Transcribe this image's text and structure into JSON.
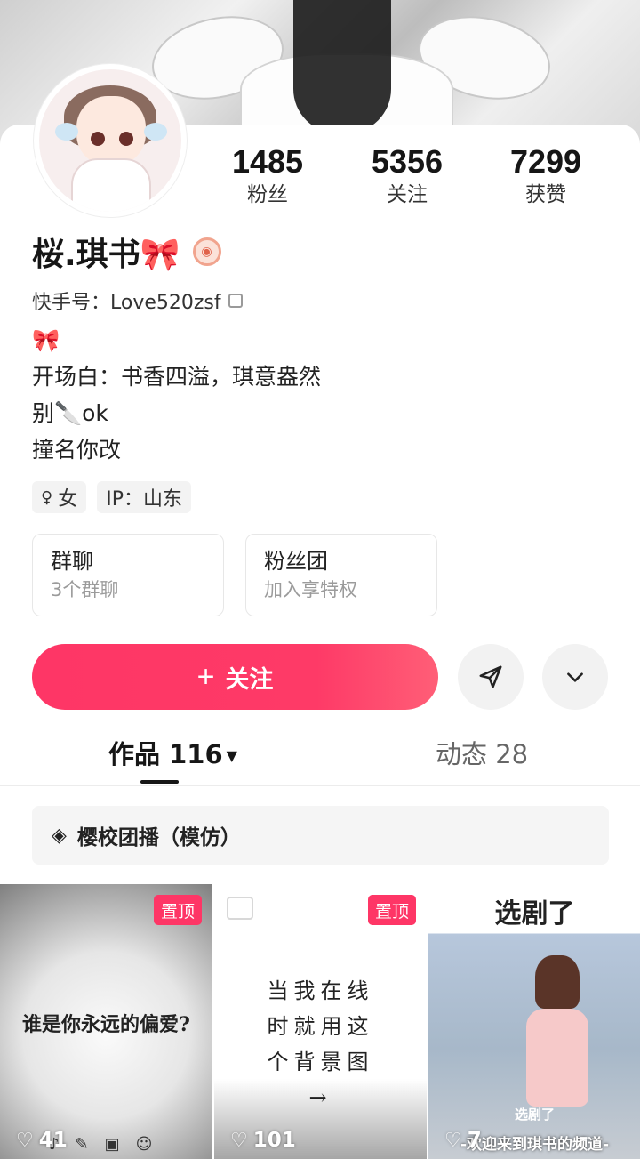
{
  "profile": {
    "name": "桜.琪书🎀",
    "kwai_id": "快手号：Love520zsf",
    "bio_lines": [
      "🎀",
      "开场白：书香四溢，琪意盎然",
      "别🔪ok",
      "撞名你改"
    ]
  },
  "stats": {
    "fans": {
      "value": "1485",
      "label": "粉丝"
    },
    "following": {
      "value": "5356",
      "label": "关注"
    },
    "likes": {
      "value": "7299",
      "label": "获赞"
    }
  },
  "tags": {
    "gender": "女",
    "ip": "IP：山东"
  },
  "cards": {
    "group_chat": {
      "title": "群聊",
      "sub": "3个群聊"
    },
    "fan_club": {
      "title": "粉丝团",
      "sub": "加入享特权"
    }
  },
  "actions": {
    "follow_label": "关注"
  },
  "tabs": {
    "works": "作品 116",
    "moments": "动态 28"
  },
  "collection": {
    "label": "樱校团播（模仿）"
  },
  "videos": [
    {
      "pin": "置顶",
      "text": "谁是你永远的偏爱?",
      "likes": "41"
    },
    {
      "pin": "置顶",
      "text": "当我在线\n时就用这\n个背景图\n→",
      "likes": "101"
    },
    {
      "title": "选剧了",
      "caption": "选剧了",
      "banner": "-欢迎来到琪书的频道-",
      "likes": "7"
    }
  ],
  "colors": {
    "accent": "#fe3666",
    "text_primary": "#161616",
    "text_secondary": "#9b9b9b"
  }
}
